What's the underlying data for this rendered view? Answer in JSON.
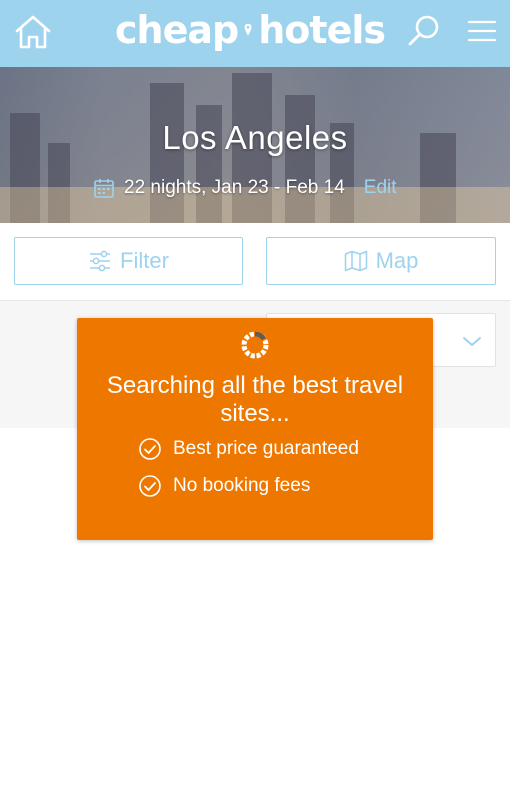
{
  "header": {
    "logo_left": "cheap",
    "logo_right": "hotels",
    "icons": [
      "home-icon",
      "map-pin-icon",
      "search-icon",
      "menu-icon"
    ]
  },
  "hero": {
    "city": "Los Angeles",
    "dates": "22 nights, Jan 23 - Feb 14",
    "edit_label": "Edit",
    "icon": "calendar-icon"
  },
  "toolbar": {
    "filter_label": "Filter",
    "map_label": "Map",
    "icons": [
      "sliders-icon",
      "map-icon"
    ]
  },
  "sort": {
    "selected_value": "",
    "icon": "chevron-down-icon"
  },
  "loading": {
    "title": "Searching all the best travel sites...",
    "features": [
      {
        "label": "Best price guaranteed",
        "icon": "check-circle-icon"
      },
      {
        "label": "No booking fees",
        "icon": "check-circle-icon"
      }
    ]
  },
  "colors": {
    "brand_blue": "#9ed3ee",
    "overlay_orange": "#ee7700",
    "white": "#ffffff"
  }
}
